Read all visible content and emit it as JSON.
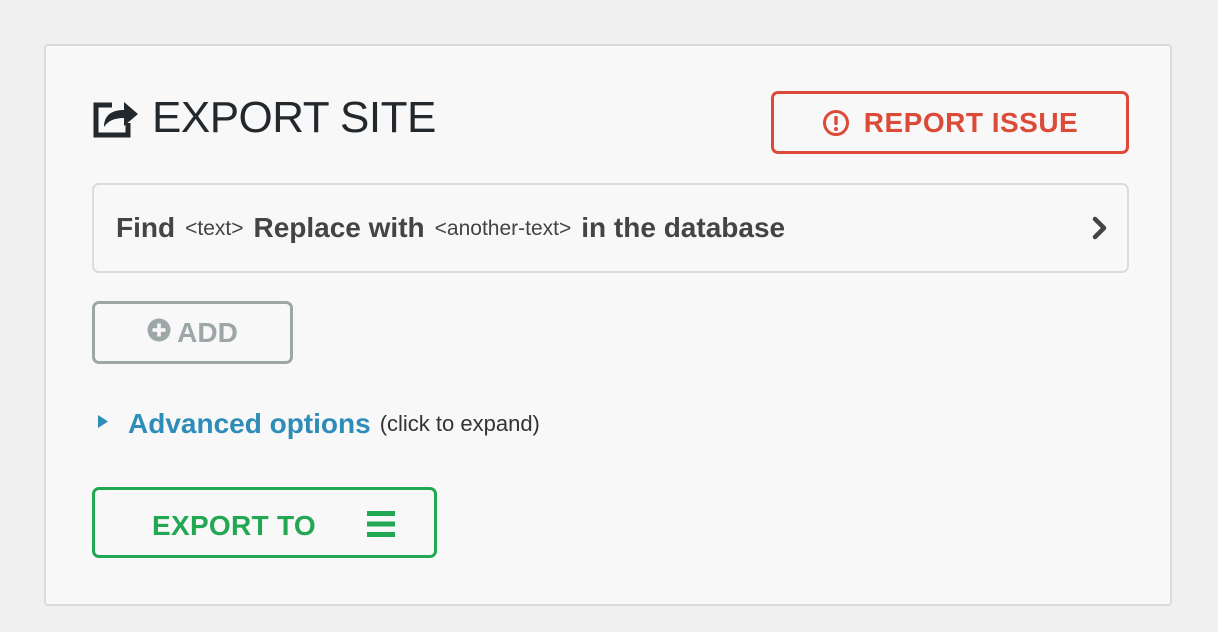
{
  "header": {
    "title": "EXPORT SITE",
    "icon": "share-export-icon"
  },
  "report_button": {
    "label": "REPORT ISSUE",
    "icon": "exclamation-circle-icon",
    "color": "#dc4a38"
  },
  "find_replace": {
    "find_label": "Find",
    "find_placeholder": "<text>",
    "replace_label": "Replace with",
    "replace_placeholder": "<another-text>",
    "suffix": "in the database",
    "icon": "chevron-right-icon"
  },
  "add_button": {
    "label": "ADD",
    "icon": "plus-circle-icon",
    "color": "#9ea7a7"
  },
  "advanced": {
    "link_label": "Advanced options",
    "hint": "(click to expand)",
    "icon": "triangle-right-icon",
    "color": "#2e8cb8"
  },
  "export_button": {
    "label": "EXPORT TO",
    "icon": "menu-icon",
    "color": "#22a752"
  }
}
